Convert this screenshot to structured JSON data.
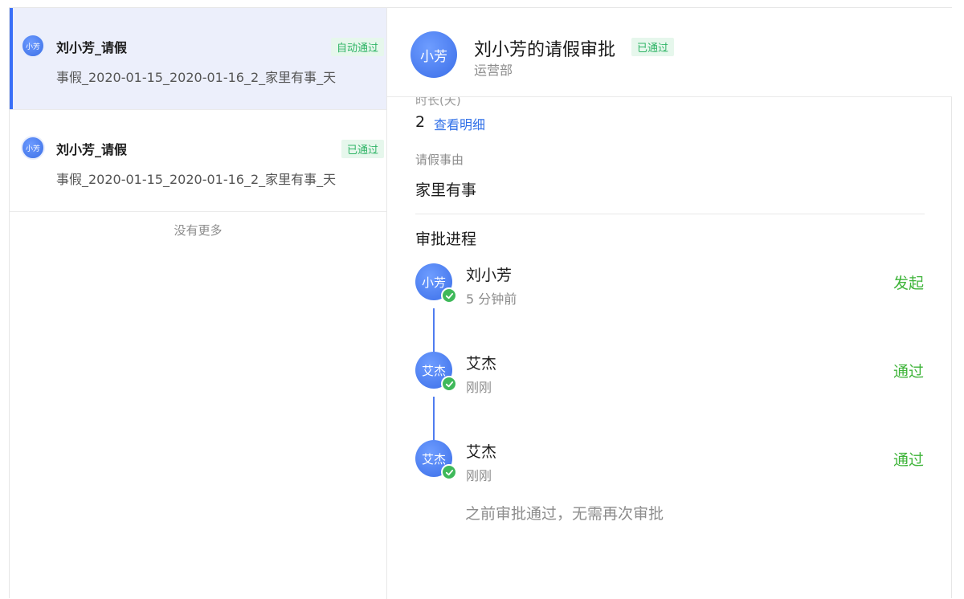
{
  "list": {
    "items": [
      {
        "avatar": "小芳",
        "title": "刘小芳_请假",
        "badge": "自动通过",
        "subtitle": "事假_2020-01-15_2020-01-16_2_家里有事_天"
      },
      {
        "avatar": "小芳",
        "title": "刘小芳_请假",
        "badge": "已通过",
        "subtitle": "事假_2020-01-15_2020-01-16_2_家里有事_天"
      }
    ],
    "no_more": "没有更多"
  },
  "detail": {
    "avatar": "小芳",
    "title": "刘小芳的请假审批",
    "badge": "已通过",
    "department": "运营部",
    "partial_label": "时长(天)",
    "days_value": "2",
    "detail_link": "查看明细",
    "reason_label": "请假事由",
    "reason_value": "家里有事",
    "process_title": "审批进程",
    "steps": [
      {
        "avatar": "小芳",
        "name": "刘小芳",
        "time": "5 分钟前",
        "status": "发起"
      },
      {
        "avatar": "艾杰",
        "name": "艾杰",
        "time": "刚刚",
        "status": "通过"
      },
      {
        "avatar": "艾杰",
        "name": "艾杰",
        "time": "刚刚",
        "status": "通过"
      }
    ],
    "note": "之前审批通过，无需再次审批"
  },
  "colors": {
    "accent": "#3a6ff7",
    "success": "#3fb43a",
    "badge_bg": "#e6f7ec"
  }
}
